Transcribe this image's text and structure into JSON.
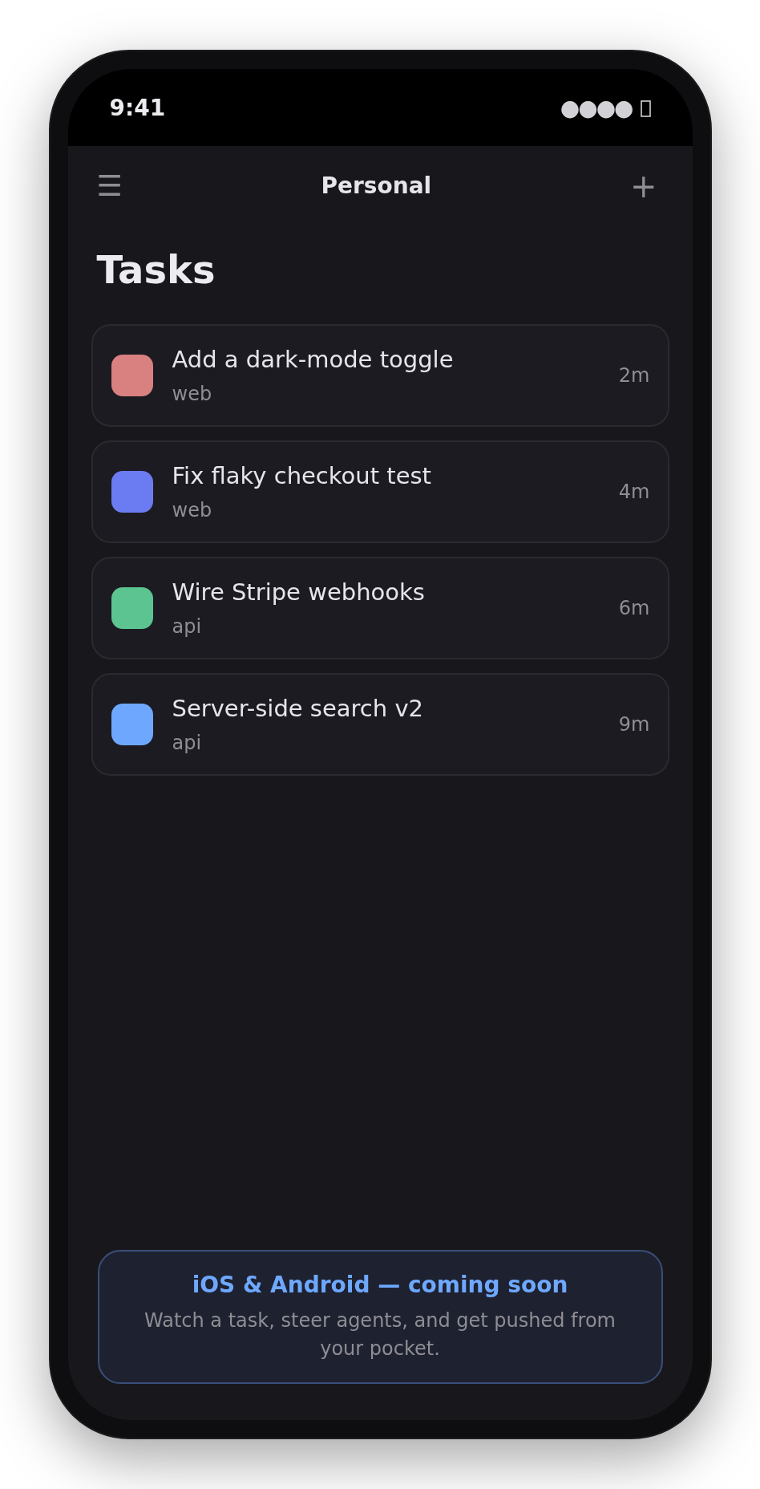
{
  "status_bar": {
    "time": "9:41",
    "signal": "●●●●"
  },
  "header": {
    "menu": "☰",
    "title": "Personal",
    "add": "+"
  },
  "page_title": "Tasks",
  "tasks": [
    {
      "title": "Add a dark-mode toggle",
      "tag": "web",
      "age": "2m",
      "color": "#d98080"
    },
    {
      "title": "Fix flaky checkout test",
      "tag": "web",
      "age": "4m",
      "color": "#6b7cf2"
    },
    {
      "title": "Wire Stripe webhooks",
      "tag": "api",
      "age": "6m",
      "color": "#5cc490"
    },
    {
      "title": "Server-side search v2",
      "tag": "api",
      "age": "9m",
      "color": "#6ea8fe"
    }
  ],
  "banner": {
    "title": "iOS & Android — coming soon",
    "text": "Watch a task, steer agents, and get pushed from your pocket."
  }
}
